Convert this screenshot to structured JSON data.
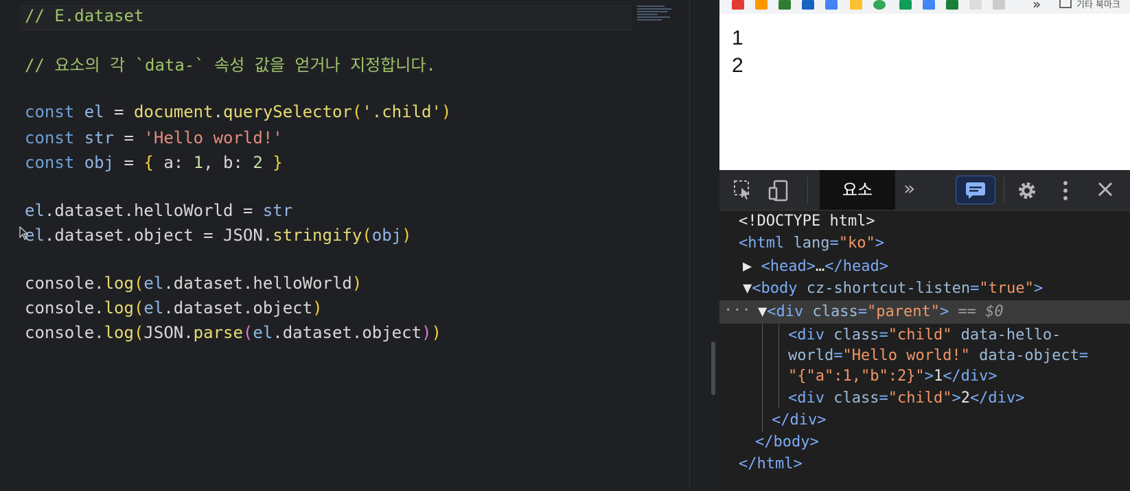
{
  "editor": {
    "lines": [
      {
        "segments": [
          {
            "t": "// E.dataset",
            "c": "c-comment"
          }
        ]
      },
      {
        "segments": [
          {
            "t": "// 요소의 각 `data-` 속성 값을 얻거나 지정합니다.",
            "c": "c-comment"
          }
        ]
      },
      {
        "segments": [
          {
            "t": "const ",
            "c": "c-kw"
          },
          {
            "t": "el",
            "c": "c-var"
          },
          {
            "t": " = ",
            "c": "c-plain"
          },
          {
            "t": "document",
            "c": "c-fn"
          },
          {
            "t": ".",
            "c": "c-plain"
          },
          {
            "t": "querySelector",
            "c": "c-fn"
          },
          {
            "t": "(",
            "c": "c-brk1"
          },
          {
            "t": "'.child'",
            "c": "c-fn"
          },
          {
            "t": ")",
            "c": "c-brk1"
          }
        ]
      },
      {
        "segments": [
          {
            "t": "const ",
            "c": "c-kw"
          },
          {
            "t": "str",
            "c": "c-var"
          },
          {
            "t": " = ",
            "c": "c-plain"
          },
          {
            "t": "'Hello world!'",
            "c": "c-str"
          }
        ]
      },
      {
        "segments": [
          {
            "t": "const ",
            "c": "c-kw"
          },
          {
            "t": "obj",
            "c": "c-var"
          },
          {
            "t": " = ",
            "c": "c-plain"
          },
          {
            "t": "{",
            "c": "c-brk1"
          },
          {
            "t": " a: ",
            "c": "c-plain"
          },
          {
            "t": "1",
            "c": "c-num"
          },
          {
            "t": ", b: ",
            "c": "c-plain"
          },
          {
            "t": "2",
            "c": "c-num"
          },
          {
            "t": " }",
            "c": "c-brk1"
          }
        ]
      },
      {
        "segments": [
          {
            "t": "el",
            "c": "c-var"
          },
          {
            "t": ".dataset.helloWorld = ",
            "c": "c-plain"
          },
          {
            "t": "str",
            "c": "c-var"
          }
        ]
      },
      {
        "segments": [
          {
            "t": "el",
            "c": "c-var"
          },
          {
            "t": ".dataset.object = ",
            "c": "c-plain"
          },
          {
            "t": "JSON",
            "c": "c-plain"
          },
          {
            "t": ".",
            "c": "c-plain"
          },
          {
            "t": "stringify",
            "c": "c-fn"
          },
          {
            "t": "(",
            "c": "c-brk1"
          },
          {
            "t": "obj",
            "c": "c-var"
          },
          {
            "t": ")",
            "c": "c-brk1"
          }
        ]
      },
      {
        "segments": [
          {
            "t": "console",
            "c": "c-plain"
          },
          {
            "t": ".",
            "c": "c-plain"
          },
          {
            "t": "log",
            "c": "c-fn"
          },
          {
            "t": "(",
            "c": "c-brk1"
          },
          {
            "t": "el",
            "c": "c-var"
          },
          {
            "t": ".dataset.helloWorld",
            "c": "c-plain"
          },
          {
            "t": ")",
            "c": "c-brk1"
          }
        ]
      },
      {
        "segments": [
          {
            "t": "console",
            "c": "c-plain"
          },
          {
            "t": ".",
            "c": "c-plain"
          },
          {
            "t": "log",
            "c": "c-fn"
          },
          {
            "t": "(",
            "c": "c-brk1"
          },
          {
            "t": "el",
            "c": "c-var"
          },
          {
            "t": ".dataset.object",
            "c": "c-plain"
          },
          {
            "t": ")",
            "c": "c-brk1"
          }
        ]
      },
      {
        "segments": [
          {
            "t": "console",
            "c": "c-plain"
          },
          {
            "t": ".",
            "c": "c-plain"
          },
          {
            "t": "log",
            "c": "c-fn"
          },
          {
            "t": "(",
            "c": "c-brk1"
          },
          {
            "t": "JSON",
            "c": "c-plain"
          },
          {
            "t": ".",
            "c": "c-plain"
          },
          {
            "t": "parse",
            "c": "c-fn"
          },
          {
            "t": "(",
            "c": "c-brk2"
          },
          {
            "t": "el",
            "c": "c-var"
          },
          {
            "t": ".dataset.object",
            "c": "c-plain"
          },
          {
            "t": ")",
            "c": "c-brk2"
          },
          {
            "t": ")",
            "c": "c-brk1"
          }
        ]
      }
    ]
  },
  "browser": {
    "bookmarks_more": "»",
    "bookmarks_other": "기타 북마크",
    "page_output": [
      "1",
      "2"
    ]
  },
  "devtools": {
    "elements_tab": "요소",
    "more_tabs": "»",
    "dom": [
      {
        "segments": [
          {
            "t": "<!DOCTYPE html>",
            "c": "t-text"
          }
        ]
      },
      {
        "segments": [
          {
            "t": "<html ",
            "c": "t-tag"
          },
          {
            "t": "lang",
            "c": "t-attr"
          },
          {
            "t": "=",
            "c": "t-tag"
          },
          {
            "t": "\"ko\"",
            "c": "t-val"
          },
          {
            "t": ">",
            "c": "t-tag"
          }
        ]
      },
      {
        "segments": [
          {
            "t": "▶ ",
            "c": "t-text"
          },
          {
            "t": "<head>",
            "c": "t-tag"
          },
          {
            "t": "…",
            "c": "t-text"
          },
          {
            "t": "</head>",
            "c": "t-tag"
          }
        ]
      },
      {
        "segments": [
          {
            "t": "▼",
            "c": "t-text"
          },
          {
            "t": "<body ",
            "c": "t-tag"
          },
          {
            "t": "cz-shortcut-listen",
            "c": "t-attr"
          },
          {
            "t": "=",
            "c": "t-tag"
          },
          {
            "t": "\"true\"",
            "c": "t-val"
          },
          {
            "t": ">",
            "c": "t-tag"
          }
        ]
      },
      {
        "segments": [
          {
            "t": "▼",
            "c": "t-text"
          },
          {
            "t": "<div ",
            "c": "t-tag"
          },
          {
            "t": "class",
            "c": "t-attr"
          },
          {
            "t": "=",
            "c": "t-tag"
          },
          {
            "t": "\"parent\"",
            "c": "t-val"
          },
          {
            "t": ">",
            "c": "t-tag"
          },
          {
            "t": " == ",
            "c": "t-dim"
          },
          {
            "t": "$0",
            "c": "t-sel"
          }
        ]
      },
      {
        "segments": [
          {
            "t": "<div ",
            "c": "t-tag"
          },
          {
            "t": "class",
            "c": "t-attr"
          },
          {
            "t": "=",
            "c": "t-tag"
          },
          {
            "t": "\"child\"",
            "c": "t-val"
          },
          {
            "t": " data-hello-",
            "c": "t-attr"
          }
        ]
      },
      {
        "segments": [
          {
            "t": "world",
            "c": "t-attr"
          },
          {
            "t": "=",
            "c": "t-tag"
          },
          {
            "t": "\"Hello world!\"",
            "c": "t-val"
          },
          {
            "t": " data-object",
            "c": "t-attr"
          },
          {
            "t": "=",
            "c": "t-tag"
          }
        ]
      },
      {
        "segments": [
          {
            "t": "\"{\"a\":1,\"b\":2}\"",
            "c": "t-val"
          },
          {
            "t": ">",
            "c": "t-tag"
          },
          {
            "t": "1",
            "c": "t-text"
          },
          {
            "t": "</div>",
            "c": "t-tag"
          }
        ]
      },
      {
        "segments": [
          {
            "t": "<div ",
            "c": "t-tag"
          },
          {
            "t": "class",
            "c": "t-attr"
          },
          {
            "t": "=",
            "c": "t-tag"
          },
          {
            "t": "\"child\"",
            "c": "t-val"
          },
          {
            "t": ">",
            "c": "t-tag"
          },
          {
            "t": "2",
            "c": "t-text"
          },
          {
            "t": "</div>",
            "c": "t-tag"
          }
        ]
      },
      {
        "segments": [
          {
            "t": "</div>",
            "c": "t-tag"
          }
        ]
      },
      {
        "segments": [
          {
            "t": "</body>",
            "c": "t-tag"
          }
        ]
      },
      {
        "segments": [
          {
            "t": "</html>",
            "c": "t-tag"
          }
        ]
      }
    ]
  }
}
